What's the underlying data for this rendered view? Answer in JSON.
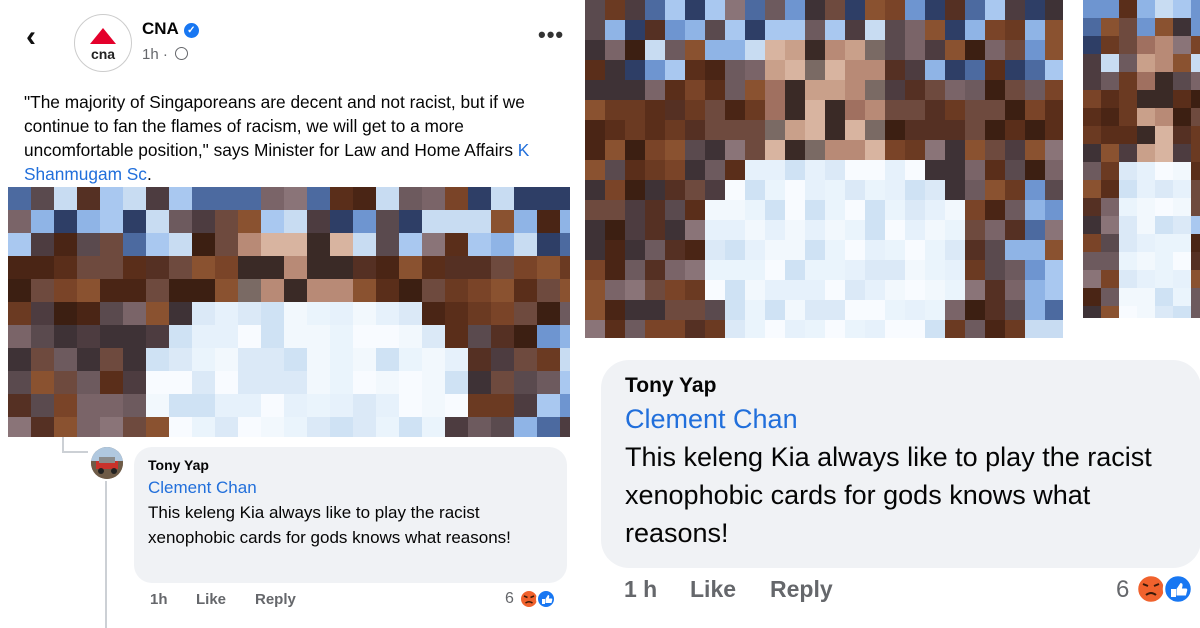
{
  "post": {
    "back_icon": "chevron-left-icon",
    "page_name": "CNA",
    "logo_text": "cna",
    "time": "1h",
    "more_icon": "more-icon",
    "caption_text": "\"The majority of Singaporeans are decent and not racist, but if we continue to fan the flames of racism, we will get to a more uncomfortable position,\" says Minister for Law and Home Affairs ",
    "caption_tag": "K Shanmugam Sc",
    "caption_end": ".",
    "brand_color": "#e4002b"
  },
  "comment": {
    "author": "Tony Yap",
    "mention": "Clement Chan",
    "text": "This keleng Kia always like to play the racist xenophobic cards for gods knows what reasons!",
    "time": "1h",
    "like_label": "Like",
    "reply_label": "Reply",
    "reaction_count": "6",
    "reactions": [
      "angry",
      "like"
    ]
  },
  "zoom_comment": {
    "author": "Tony Yap",
    "mention": "Clement Chan",
    "text": "This keleng Kia always like to play the racist xenophobic cards for gods knows what reasons!",
    "time": "1 h",
    "like_label": "Like",
    "reply_label": "Reply",
    "reaction_count": "6"
  }
}
